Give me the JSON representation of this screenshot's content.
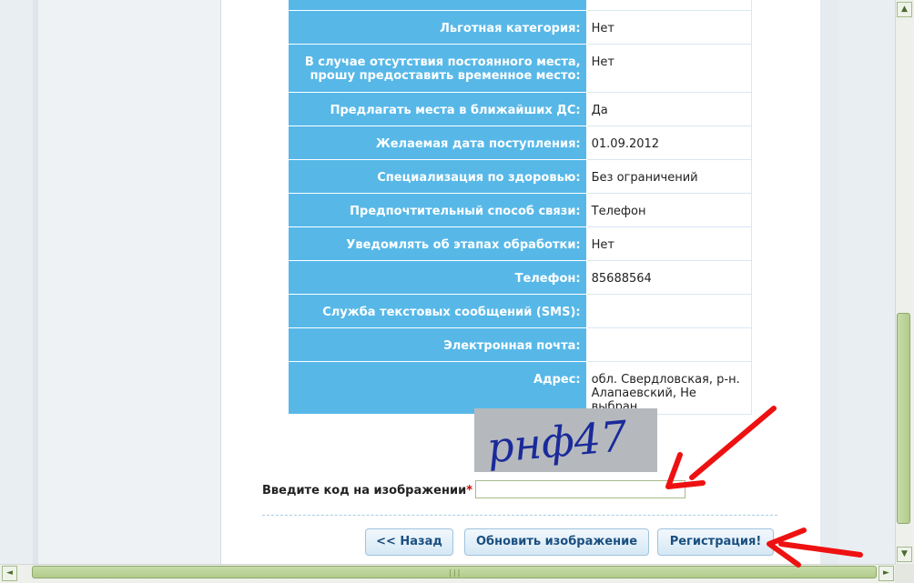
{
  "form": {
    "rows": [
      {
        "label": "",
        "value": ""
      },
      {
        "label": "Льготная категория:",
        "value": "Нет"
      },
      {
        "label": "В случае отсутствия постоянного места, прошу предоставить временное место:",
        "value": "Нет"
      },
      {
        "label": "Предлагать места в ближайших ДС:",
        "value": "Да"
      },
      {
        "label": "Желаемая дата поступления:",
        "value": "01.09.2012"
      },
      {
        "label": "Специализация по здоровью:",
        "value": "Без ограничений"
      },
      {
        "label": "Предпочтительный способ связи:",
        "value": "Телефон"
      },
      {
        "label": "Уведомлять об этапах обработки:",
        "value": "Нет"
      },
      {
        "label": "Телефон:",
        "value": "85688564"
      },
      {
        "label": "Служба текстовых сообщений (SMS):",
        "value": ""
      },
      {
        "label": "Электронная почта:",
        "value": ""
      },
      {
        "label": "Адрес:",
        "value": "обл. Свердловская, р-н. Алапаевский, Не выбран"
      }
    ]
  },
  "captcha": {
    "image_text": "рнф47",
    "label": "Введите код на изображении",
    "required_mark": "*",
    "input_value": "",
    "colors": {
      "image_bg": "#b5b9bd",
      "image_text": "#1a2a9a"
    }
  },
  "buttons": {
    "back": "<< Назад",
    "refresh": "Обновить изображение",
    "register": "Регистрация!"
  },
  "scrollbars": {
    "up_arrow": "▲",
    "down_arrow": "▼",
    "left_arrow": "◄",
    "right_arrow": "►",
    "grip": "|||"
  },
  "colors": {
    "label_bg": "#57b8e8",
    "arrow": "#ee1111",
    "button_text": "#1a4f80"
  }
}
